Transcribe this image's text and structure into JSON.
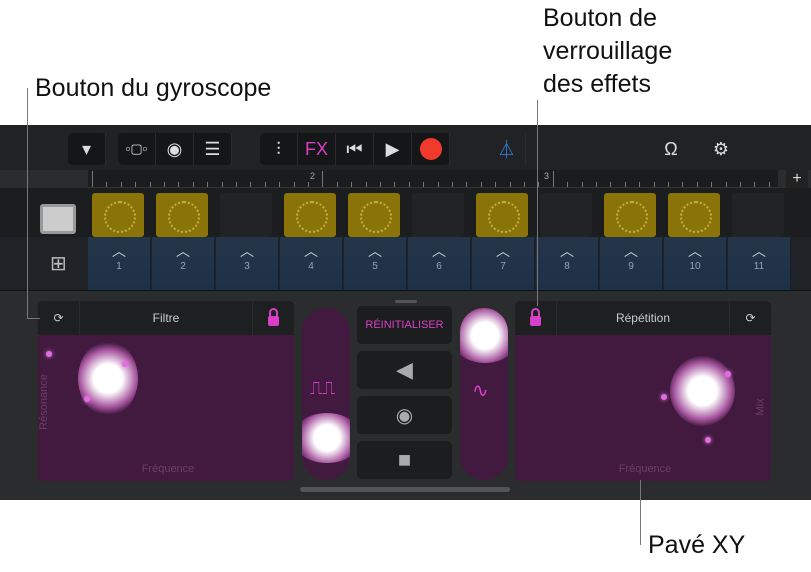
{
  "callouts": {
    "gyro": "Bouton du gyroscope",
    "lock": "Bouton de verrouillage des effets",
    "lock_lines": [
      "Bouton de",
      "verrouillage",
      "des effets"
    ],
    "xy": "Pavé XY"
  },
  "toolbar": {
    "fx": "FX",
    "colors": {
      "fx": "#d93fc6",
      "record": "#f23a2c",
      "metronome": "#2f86f0"
    }
  },
  "ruler": {
    "marks": [
      "2",
      "3"
    ],
    "add": "+"
  },
  "tracks": {
    "cells": [
      true,
      true,
      false,
      true,
      true,
      false,
      true,
      false,
      true,
      true,
      false
    ]
  },
  "pads": [
    "1",
    "2",
    "3",
    "4",
    "5",
    "6",
    "7",
    "8",
    "9",
    "10",
    "11"
  ],
  "left_xy": {
    "title": "Filtre",
    "x_label": "Fréquence",
    "y_label": "Résonance"
  },
  "right_xy": {
    "title": "Répétition",
    "x_label": "Fréquence",
    "y_label": "Mix"
  },
  "center": {
    "reset": "RÉINITIALISER"
  }
}
